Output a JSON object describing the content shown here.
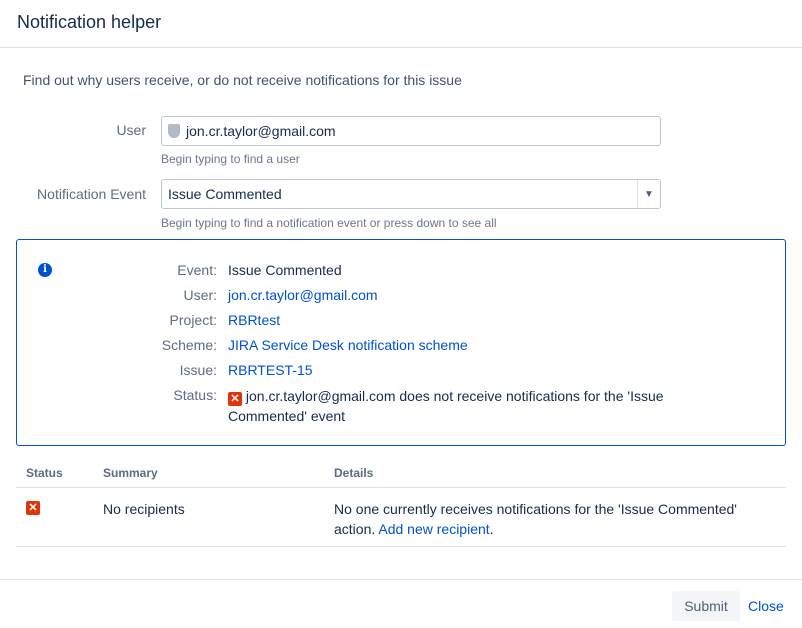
{
  "dialog": {
    "title": "Notification helper"
  },
  "intro": "Find out why users receive, or do not receive notifications for this issue",
  "form": {
    "user": {
      "label": "User",
      "value": "jon.cr.taylor@gmail.com",
      "help": "Begin typing to find a user"
    },
    "event": {
      "label": "Notification Event",
      "value": "Issue Commented",
      "help": "Begin typing to find a notification event or press down to see all"
    }
  },
  "info": {
    "icon": "info-icon",
    "rows": [
      {
        "label": "Event:",
        "value": "Issue Commented"
      },
      {
        "label": "User:",
        "value": "jon.cr.taylor@gmail.com"
      },
      {
        "label": "Project:",
        "value": "RBRtest"
      },
      {
        "label": "Scheme:",
        "value": "JIRA Service Desk notification scheme"
      },
      {
        "label": "Issue:",
        "value": "RBRTEST-15"
      }
    ],
    "status_label": "Status:",
    "status_text_1": "jon.cr.taylor@gmail.com does not receive notifications for the 'Issue",
    "status_text_2": "Commented' event"
  },
  "table": {
    "headers": {
      "status": "Status",
      "summary": "Summary",
      "details": "Details"
    },
    "row": {
      "summary": "No recipients",
      "details_1": "No one currently receives notifications for the 'Issue Commented'",
      "details_2": "action.",
      "details_link": "Add new recipient",
      "details_end": "."
    }
  },
  "footer": {
    "submit": "Submit",
    "close": "Close"
  },
  "colors": {
    "accent": "#0052cc",
    "error": "#de350b"
  }
}
